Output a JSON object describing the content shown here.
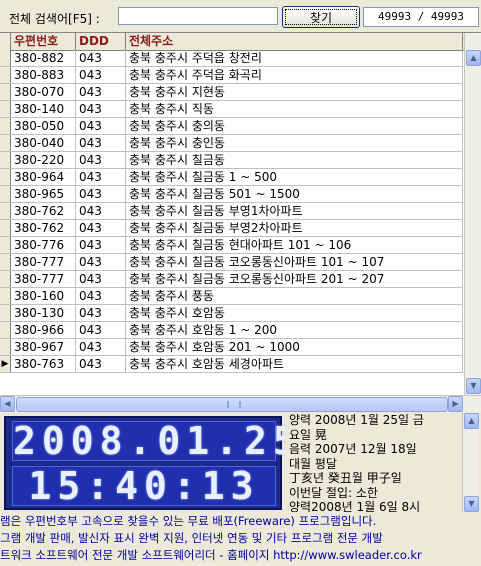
{
  "search": {
    "label": "전체 검색어[F5] :",
    "value": "",
    "button": "찾기",
    "count": "49993 / 49993"
  },
  "grid": {
    "columns": [
      "우편번호",
      "DDD",
      "전체주소"
    ],
    "rows": [
      {
        "zip": "380-882",
        "ddd": "043",
        "addr": "충북 충주시 주덕읍 창전리"
      },
      {
        "zip": "380-883",
        "ddd": "043",
        "addr": "충북 충주시 주덕읍 화곡리"
      },
      {
        "zip": "380-070",
        "ddd": "043",
        "addr": "충북 충주시 지현동"
      },
      {
        "zip": "380-140",
        "ddd": "043",
        "addr": "충북 충주시 직동"
      },
      {
        "zip": "380-050",
        "ddd": "043",
        "addr": "충북 충주시 충의동"
      },
      {
        "zip": "380-040",
        "ddd": "043",
        "addr": "충북 충주시 충인동"
      },
      {
        "zip": "380-220",
        "ddd": "043",
        "addr": "충북 충주시 칠금동"
      },
      {
        "zip": "380-964",
        "ddd": "043",
        "addr": "충북 충주시 칠금동 1 ~ 500"
      },
      {
        "zip": "380-965",
        "ddd": "043",
        "addr": "충북 충주시 칠금동 501 ~ 1500"
      },
      {
        "zip": "380-762",
        "ddd": "043",
        "addr": "충북 충주시 칠금동 부영1차아파트"
      },
      {
        "zip": "380-762",
        "ddd": "043",
        "addr": "충북 충주시 칠금동 부영2차아파트"
      },
      {
        "zip": "380-776",
        "ddd": "043",
        "addr": "충북 충주시 칠금동 현대아파트 101 ~ 106"
      },
      {
        "zip": "380-777",
        "ddd": "043",
        "addr": "충북 충주시 칠금동 코오롱동신아파트 101 ~ 107"
      },
      {
        "zip": "380-777",
        "ddd": "043",
        "addr": "충북 충주시 칠금동 코오롱동신아파트 201 ~ 207"
      },
      {
        "zip": "380-160",
        "ddd": "043",
        "addr": "충북 충주시 풍동"
      },
      {
        "zip": "380-130",
        "ddd": "043",
        "addr": "충북 충주시 호암동"
      },
      {
        "zip": "380-966",
        "ddd": "043",
        "addr": "충북 충주시 호암동 1 ~ 200"
      },
      {
        "zip": "380-967",
        "ddd": "043",
        "addr": "충북 충주시 호암동 201 ~ 1000"
      },
      {
        "zip": "380-763",
        "ddd": "043",
        "addr": "충북 충주시 호암동 세경아파트"
      }
    ],
    "current_row_index": 18
  },
  "clock": {
    "date": "2008.01.25",
    "time": "15:40:13",
    "color_bg": "#1c2a8c",
    "color_digit": "#e8f0ff"
  },
  "calendar": {
    "lines": [
      "양력 2008년 1월 25일 금",
      "요일 晃",
      "  음력 2007년 12월 18일",
      "대월 평달",
      "  丁亥년 癸丑월 甲子일",
      "  이번달 절입: 소한",
      "양력2008년 1월 6일 8시"
    ]
  },
  "footer": {
    "lines": [
      "램은 우편번호부 고속으로 찾을수 있는 무료 배포(Freeware) 프로그램입니다.",
      "그램 개발 판매, 발신자 표시 완벽 지원, 인터넷 연동 및 기타 프로그램 전문 개발",
      "트워크 소프트웨어 전문 개발 소프트웨어리더 - 홈페이지 http://www.swleader.co.kr"
    ]
  },
  "icons": [
    "scroll-up-icon",
    "scroll-down-icon",
    "scroll-left-icon",
    "scroll-right-icon",
    "row-pointer-icon"
  ]
}
